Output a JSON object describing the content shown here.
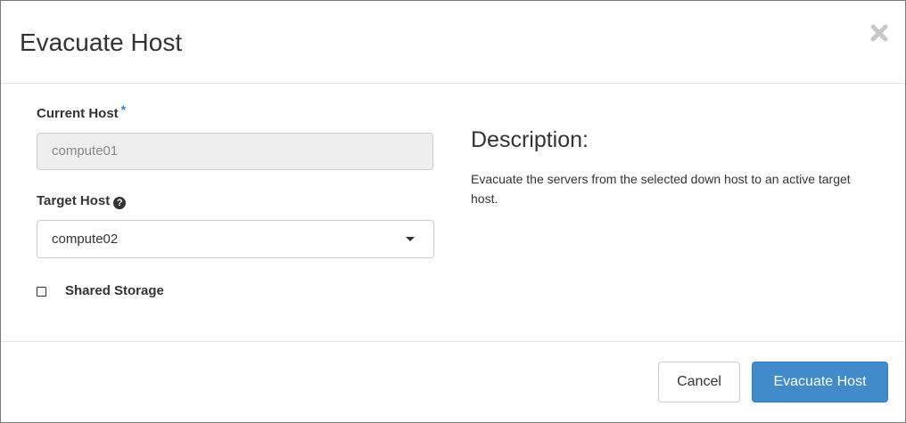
{
  "modal": {
    "title": "Evacuate Host",
    "close_icon": "close-icon"
  },
  "form": {
    "current_host": {
      "label": "Current Host",
      "required_marker": "*",
      "value": "compute01"
    },
    "target_host": {
      "label": "Target Host",
      "help_icon": "question-circle-icon",
      "help_glyph": "?",
      "selected": "compute02"
    },
    "shared_storage": {
      "label": "Shared Storage",
      "checked": false
    }
  },
  "description": {
    "heading": "Description:",
    "text": "Evacuate the servers from the selected down host to an active target host."
  },
  "footer": {
    "cancel_label": "Cancel",
    "submit_label": "Evacuate Host"
  },
  "colors": {
    "primary": "#428bca",
    "required": "#3a87c8",
    "readonly_bg": "#eeeeee"
  }
}
